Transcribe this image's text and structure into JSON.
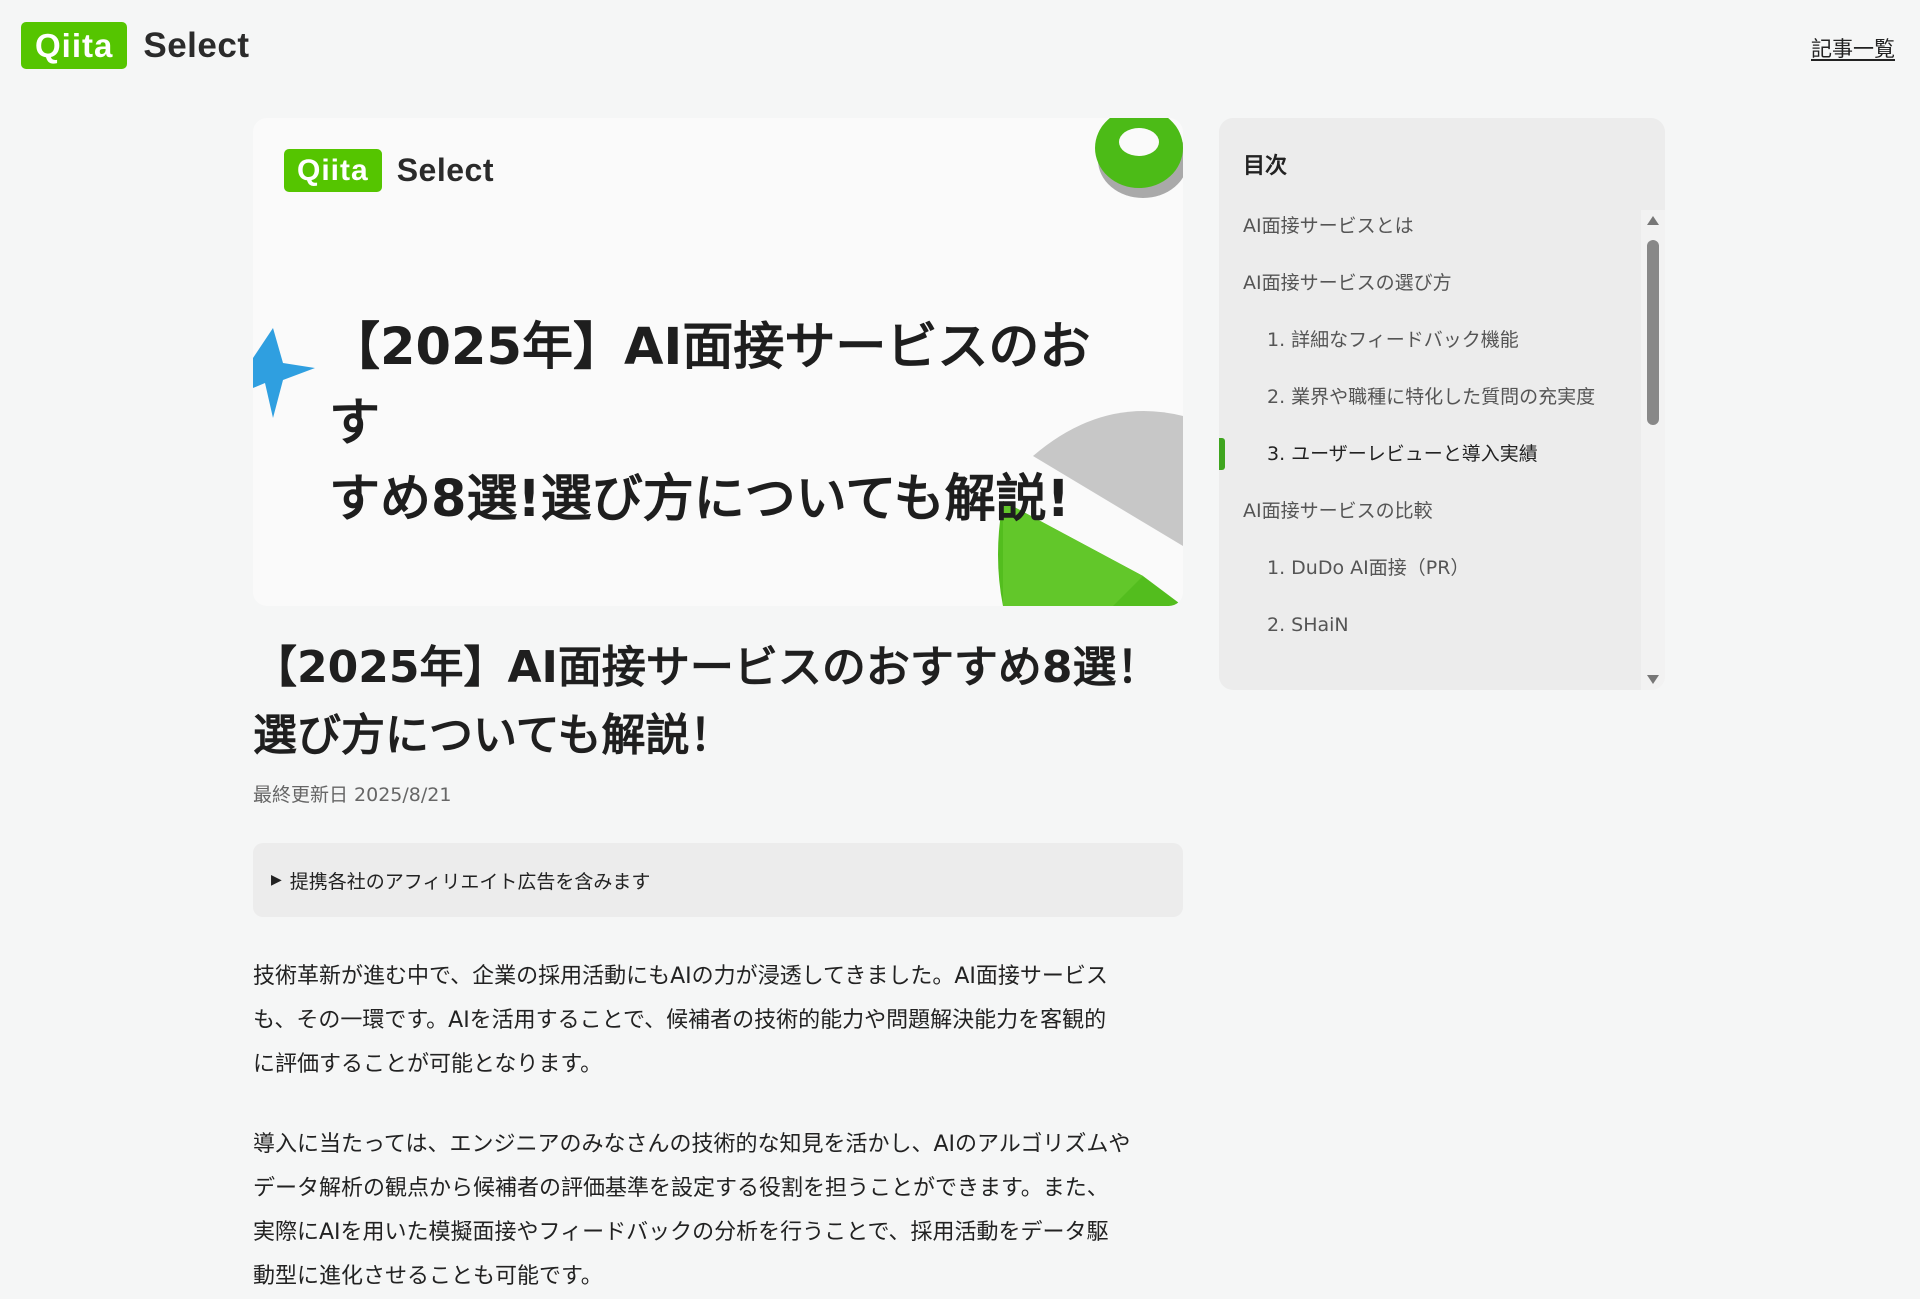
{
  "header": {
    "logo_badge": "Qiita",
    "logo_text": "Select",
    "nav_link": "記事一覧"
  },
  "hero": {
    "logo_badge": "Qiita",
    "logo_text": "Select",
    "title_line1": "【2025年】AI面接サービスのおす",
    "title_line2": "すめ8選!選び方についても解説!"
  },
  "article": {
    "title_line1": "【2025年】AI面接サービスのおすすめ8選！",
    "title_line2": "選び方についても解説！",
    "updated": "最終更新日 2025/8/21",
    "affiliate_marker": "▶",
    "affiliate": "提携各社のアフィリエイト広告を含みます",
    "paragraph1": [
      "技術革新が進む中で、企業の採用活動にもAIの力が浸透してきました。AI面接サービス",
      "も、その一環です。AIを活用することで、候補者の技術的能力や問題解決能力を客観的",
      "に評価することが可能となります。"
    ],
    "paragraph2": [
      "導入に当たっては、エンジニアのみなさんの技術的な知見を活かし、AIのアルゴリズムや",
      "データ解析の観点から候補者の評価基準を設定する役割を担うことができます。また、",
      "実際にAIを用いた模擬面接やフィードバックの分析を行うことで、採用活動をデータ駆",
      "動型に進化させることも可能です。"
    ]
  },
  "toc": {
    "title": "目次",
    "items": [
      {
        "label": "AI面接サービスとは",
        "level": 1,
        "active": false
      },
      {
        "label": "AI面接サービスの選び方",
        "level": 1,
        "active": false
      },
      {
        "label": "1. 詳細なフィードバック機能",
        "level": 2,
        "active": false
      },
      {
        "label": "2. 業界や職種に特化した質問の充実度",
        "level": 2,
        "active": false
      },
      {
        "label": "3. ユーザーレビューと導入実績",
        "level": 2,
        "active": true
      },
      {
        "label": "AI面接サービスの比較",
        "level": 1,
        "active": false
      },
      {
        "label": "1. DuDo AI面接（PR）",
        "level": 2,
        "active": false
      },
      {
        "label": "2. SHaiN",
        "level": 2,
        "active": false
      }
    ]
  },
  "colors": {
    "brand": "#55c500",
    "toc_active": "#3fa51f"
  }
}
